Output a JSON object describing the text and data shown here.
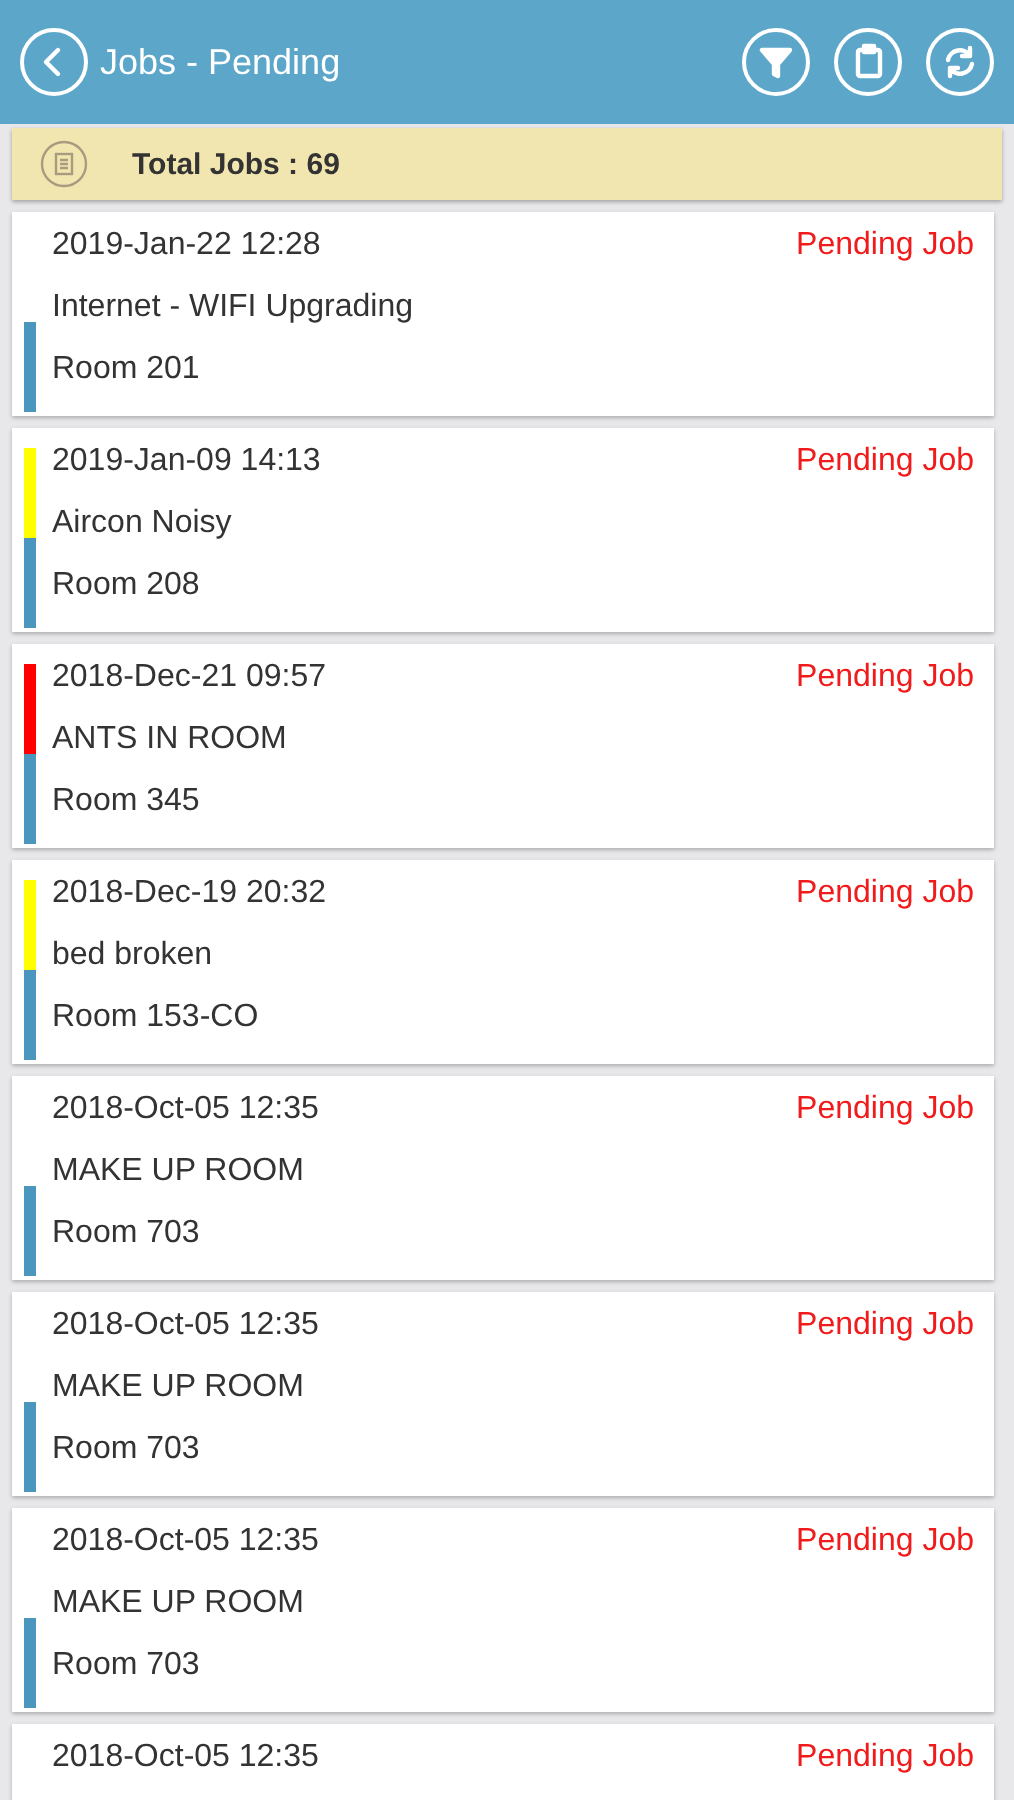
{
  "header": {
    "title": "Jobs - Pending"
  },
  "summary": {
    "label": "Total Jobs : 69"
  },
  "jobs": [
    {
      "datetime": "2019-Jan-22 12:28",
      "status": "Pending Job",
      "title": "Internet - WIFI Upgrading",
      "location": "Room 201"
    },
    {
      "datetime": "2019-Jan-09 14:13",
      "status": "Pending Job",
      "title": "Aircon Noisy",
      "location": "Room 208",
      "color": "#ffff00"
    },
    {
      "datetime": "2018-Dec-21 09:57",
      "status": "Pending Job",
      "title": "ANTS IN ROOM",
      "location": "Room 345",
      "color": "#ff0000"
    },
    {
      "datetime": "2018-Dec-19 20:32",
      "status": "Pending Job",
      "title": "bed broken",
      "location": "Room 153-CO",
      "color": "#ffff00"
    },
    {
      "datetime": "2018-Oct-05 12:35",
      "status": "Pending Job",
      "title": "MAKE UP ROOM",
      "location": "Room 703"
    },
    {
      "datetime": "2018-Oct-05 12:35",
      "status": "Pending Job",
      "title": "MAKE UP ROOM",
      "location": "Room 703"
    },
    {
      "datetime": "2018-Oct-05 12:35",
      "status": "Pending Job",
      "title": "MAKE UP ROOM",
      "location": "Room 703"
    },
    {
      "datetime": "2018-Oct-05 12:35",
      "status": "Pending Job"
    }
  ]
}
